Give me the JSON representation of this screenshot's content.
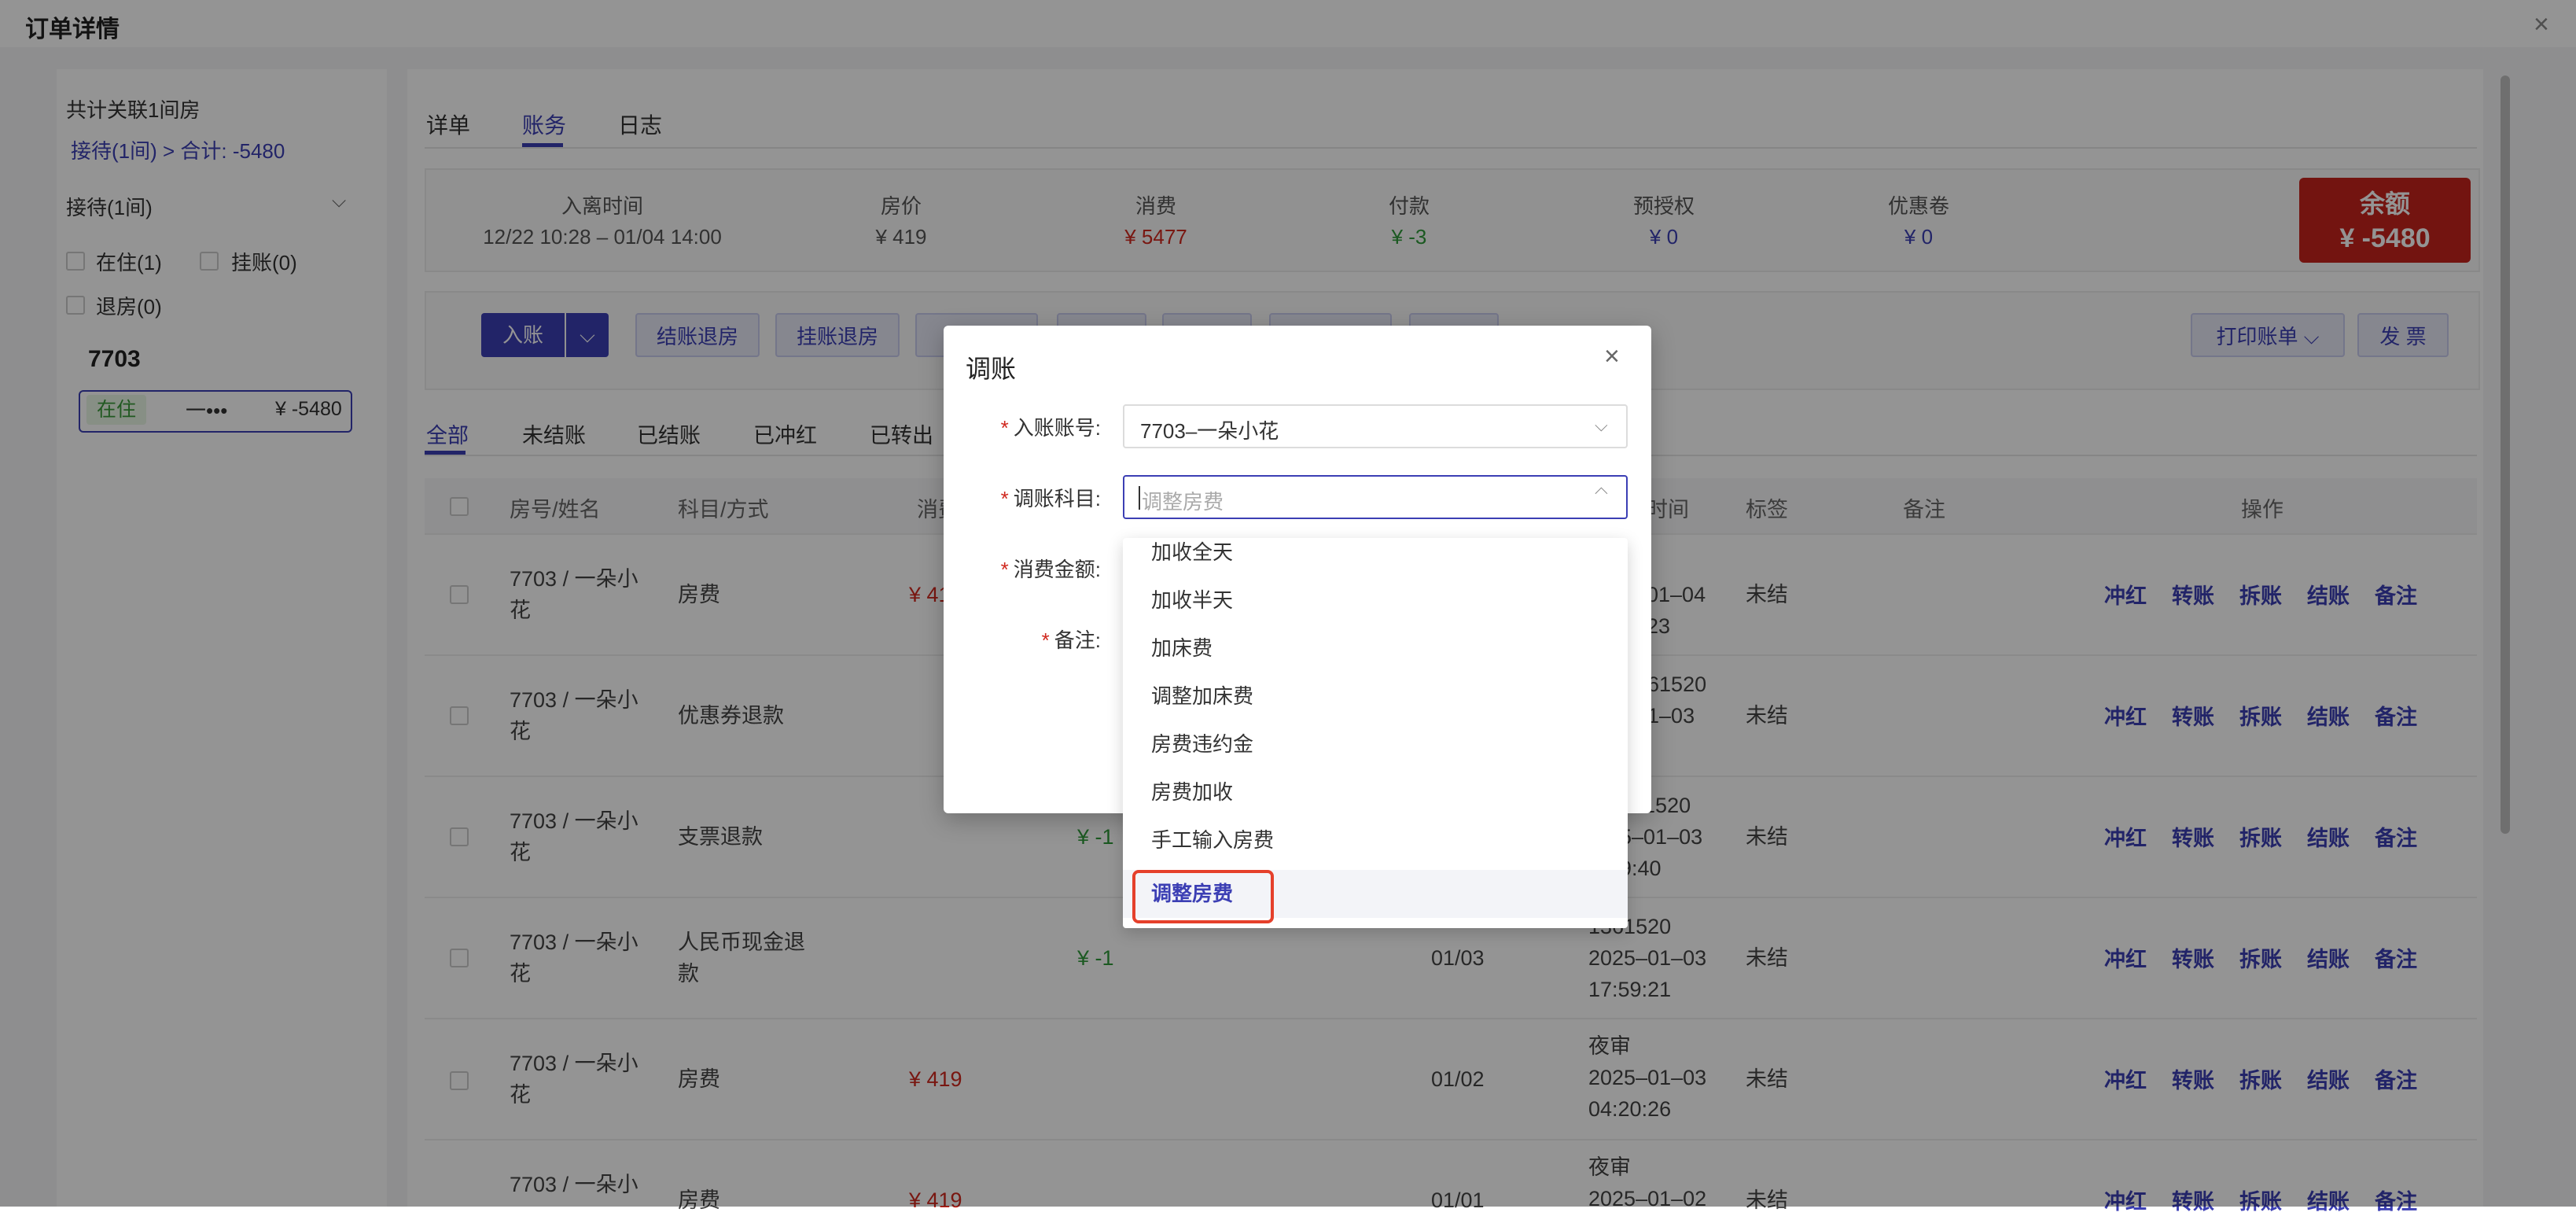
{
  "page": {
    "title": "订单详情",
    "close": "×"
  },
  "left": {
    "linked_rooms": "共计关联1间房",
    "summary_link": "接待(1间) > 合计: -5480",
    "group_label": "接待(1间)",
    "filters": [
      "在住(1)",
      "挂账(0)",
      "退房(0)"
    ],
    "room_no": "7703",
    "room_status": "在住",
    "room_guest": "一•••",
    "room_amount": "¥ -5480"
  },
  "tabs": [
    "详单",
    "账务",
    "日志"
  ],
  "summary": {
    "labels": [
      "入离时间",
      "房价",
      "消费",
      "付款",
      "预授权",
      "优惠卷"
    ],
    "values": [
      "12/22 10:28 – 01/04 14:00",
      "¥ 419",
      "¥ 5477",
      "¥ -3",
      "¥ 0",
      "¥ 0"
    ],
    "balance_label": "余额",
    "balance_value": "¥ -5480"
  },
  "actions": {
    "post": "入账",
    "checkout": "结账退房",
    "hang_checkout": "挂账退房",
    "print": "打印账单",
    "invoice": "发 票"
  },
  "filter_tabs": [
    "全部",
    "未结账",
    "已结账",
    "已冲红",
    "已转出"
  ],
  "table": {
    "headers": [
      "房号/姓名",
      "科目/方式",
      "消费",
      "时间",
      "标签",
      "备注",
      "操作"
    ],
    "rows": [
      {
        "room": [
          "7703 / 一朵小",
          "花"
        ],
        "item": [
          "房费"
        ],
        "amount": "¥ 41",
        "type": "red",
        "biz": "",
        "time": [
          "01–04",
          "23"
        ],
        "tag": "未结"
      },
      {
        "room": [
          "7703 / 一朵小",
          "花"
        ],
        "item": [
          "优惠券退款"
        ],
        "amount": "",
        "type": "",
        "biz": "",
        "time": [
          "961520",
          "01–03",
          "6"
        ],
        "tag": "未结"
      },
      {
        "room": [
          "7703 / 一朵小",
          "花"
        ],
        "item": [
          "支票退款"
        ],
        "amount": "¥ -1",
        "type": "green",
        "biz": "",
        "time": [
          "961520",
          "5–01–03",
          "9:40"
        ],
        "tag": "未结"
      },
      {
        "room": [
          "7703 / 一朵小",
          "花"
        ],
        "item": [
          "人民币现金退",
          "款"
        ],
        "amount": "¥ -1",
        "type": "green",
        "biz": "01/03",
        "time": [
          "1361520",
          "2025–01–03",
          "17:59:21"
        ],
        "tag": "未结"
      },
      {
        "room": [
          "7703 / 一朵小",
          "花"
        ],
        "item": [
          "房费"
        ],
        "amount": "¥ 419",
        "type": "red",
        "biz": "01/02",
        "time": [
          "夜审",
          "2025–01–03",
          "04:20:26"
        ],
        "tag": "未结"
      },
      {
        "room": [
          "7703 / 一朵小"
        ],
        "item": [
          "房费"
        ],
        "amount": "¥ 419",
        "type": "red",
        "biz": "01/01",
        "time": [
          "夜审",
          "2025–01–02"
        ],
        "tag": "未结"
      }
    ],
    "ops": [
      "冲红",
      "转账",
      "拆账",
      "结账",
      "备注"
    ]
  },
  "modal": {
    "title": "调账",
    "close": "×",
    "account_label": "入账账号:",
    "account_value": "7703–一朵小花",
    "subject_label": "调账科目:",
    "subject_placeholder": "调整房费",
    "amount_label": "消费金额:",
    "note_label": "备注:",
    "required_mark": "*"
  },
  "dropdown": {
    "options": [
      "加收全天",
      "加收半天",
      "加床费",
      "调整加床费",
      "房费违约金",
      "房费加收",
      "手工输入房费",
      "调整房费"
    ],
    "selected": "调整房费"
  },
  "colors": {
    "accent": "#3c3fb4",
    "danger": "#d0281e",
    "success": "#2f9a3a",
    "balance_bg": "#c7231d",
    "highlight": "#e5402b"
  }
}
